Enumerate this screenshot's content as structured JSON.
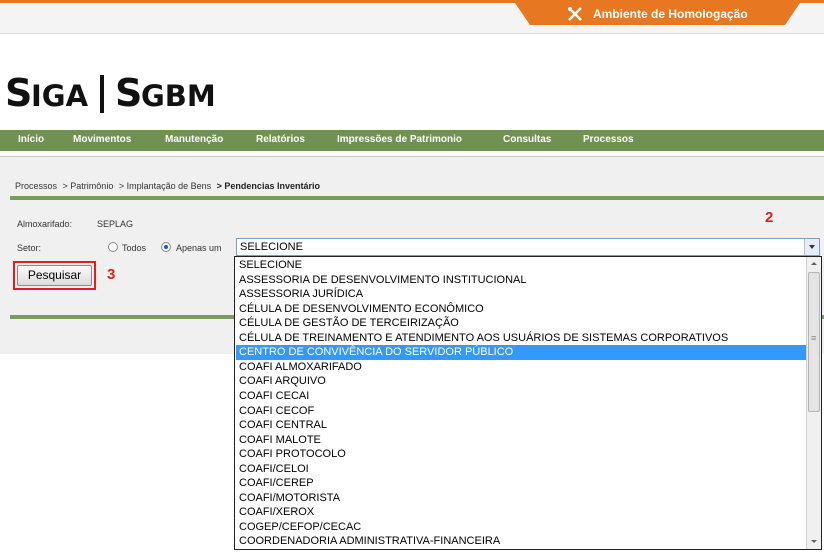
{
  "environment": {
    "label": "Ambiente de Homologação",
    "icon": "tools-icon",
    "accent": "#e87722"
  },
  "logo": {
    "text": "SIGA | SGBM"
  },
  "nav": {
    "items": [
      "Início",
      "Movimentos",
      "Manutenção",
      "Relatórios",
      "Impressões de Patrimonio",
      "Consultas",
      "Processos"
    ],
    "color": "#6f9250"
  },
  "breadcrumb": {
    "items": [
      "Processos",
      "> Patrimônio",
      "> Implantação de Bens"
    ],
    "current": "> Pendencias Inventário"
  },
  "form": {
    "almoxarifado_label": "Almoxarifado:",
    "almoxarifado_value": "SEPLAG",
    "setor_label": "Setor:",
    "radio_todos": "Todos",
    "radio_apenas": "Apenas um",
    "selected_radio": "Apenas um",
    "select_value": "SELECIONE",
    "search_button": "Pesquisar"
  },
  "annotations": {
    "marker_2": "2",
    "marker_3": "3",
    "color": "#e02020"
  },
  "dropdown": {
    "highlighted": "CENTRO DE CONVIVÊNCIA DO SERVIDOR PÚBLICO",
    "options": [
      "SELECIONE",
      "ASSESSORIA DE DESENVOLVIMENTO INSTITUCIONAL",
      "ASSESSORIA JURÍDICA",
      "CÉLULA DE DESENVOLVIMENTO ECONÔMICO",
      "CÉLULA DE GESTÃO DE TERCEIRIZAÇÃO",
      "CÉLULA DE TREINAMENTO E ATENDIMENTO AOS USUÁRIOS DE SISTEMAS CORPORATIVOS",
      "CENTRO DE CONVIVÊNCIA DO SERVIDOR PÚBLICO",
      "COAFI ALMOXARIFADO",
      "COAFI ARQUIVO",
      "COAFI CECAI",
      "COAFI CECOF",
      "COAFI CENTRAL",
      "COAFI MALOTE",
      "COAFI PROTOCOLO",
      "COAFI/CELOI",
      "COAFI/CEREP",
      "COAFI/MOTORISTA",
      "COAFI/XEROX",
      "COGEP/CEFOP/CECAC",
      "COORDENADORIA ADMINISTRATIVA-FINANCEIRA"
    ]
  }
}
